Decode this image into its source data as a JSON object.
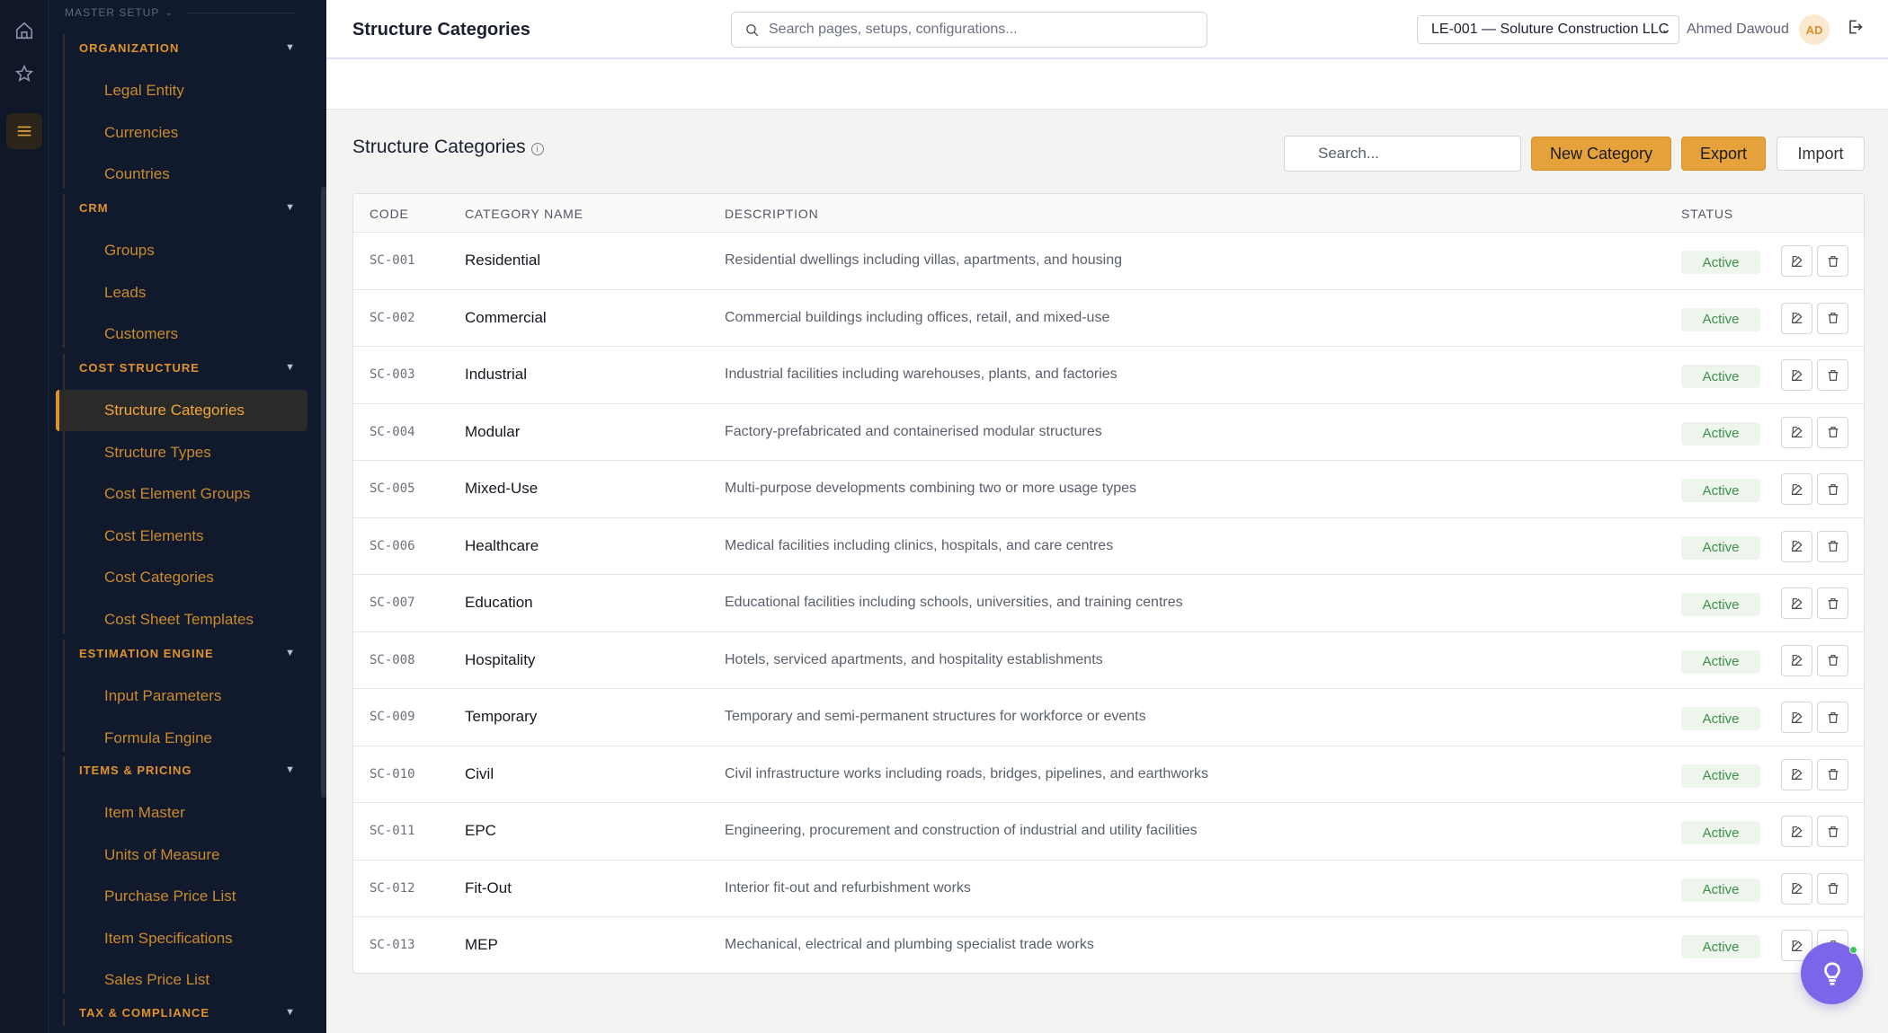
{
  "sidebar": {
    "section_label": "MASTER SETUP",
    "groups": [
      {
        "title": "ORGANIZATION",
        "items": [
          "Legal Entity",
          "Currencies",
          "Countries"
        ]
      },
      {
        "title": "CRM",
        "items": [
          "Groups",
          "Leads",
          "Customers"
        ]
      },
      {
        "title": "COST STRUCTURE",
        "items": [
          "Structure Categories",
          "Structure Types",
          "Cost Element Groups",
          "Cost Elements",
          "Cost Categories",
          "Cost Sheet Templates"
        ]
      },
      {
        "title": "ESTIMATION ENGINE",
        "items": [
          "Input Parameters",
          "Formula Engine"
        ]
      },
      {
        "title": "ITEMS & PRICING",
        "items": [
          "Item Master",
          "Units of Measure",
          "Purchase Price List",
          "Item Specifications",
          "Sales Price List"
        ]
      },
      {
        "title": "TAX & COMPLIANCE",
        "items": []
      }
    ],
    "active_item": "Structure Categories"
  },
  "header": {
    "title": "Structure Categories",
    "search_placeholder": "Search pages, setups, configurations...",
    "entity": "LE-001 — Soluture Construction LLC",
    "user_name": "Ahmed Dawoud",
    "avatar_initials": "AD"
  },
  "main": {
    "title": "Structure Categories",
    "info_glyph": "i",
    "search_placeholder": "Search...",
    "buttons": {
      "new": "New Category",
      "export": "Export",
      "import": "Import"
    },
    "columns": {
      "code": "CODE",
      "name": "CATEGORY NAME",
      "description": "DESCRIPTION",
      "status": "STATUS"
    },
    "rows": [
      {
        "code": "SC-001",
        "name": "Residential",
        "description": "Residential dwellings including villas, apartments, and housing",
        "status": "Active"
      },
      {
        "code": "SC-002",
        "name": "Commercial",
        "description": "Commercial buildings including offices, retail, and mixed-use",
        "status": "Active"
      },
      {
        "code": "SC-003",
        "name": "Industrial",
        "description": "Industrial facilities including warehouses, plants, and factories",
        "status": "Active"
      },
      {
        "code": "SC-004",
        "name": "Modular",
        "description": "Factory-prefabricated and containerised modular structures",
        "status": "Active"
      },
      {
        "code": "SC-005",
        "name": "Mixed-Use",
        "description": "Multi-purpose developments combining two or more usage types",
        "status": "Active"
      },
      {
        "code": "SC-006",
        "name": "Healthcare",
        "description": "Medical facilities including clinics, hospitals, and care centres",
        "status": "Active"
      },
      {
        "code": "SC-007",
        "name": "Education",
        "description": "Educational facilities including schools, universities, and training centres",
        "status": "Active"
      },
      {
        "code": "SC-008",
        "name": "Hospitality",
        "description": "Hotels, serviced apartments, and hospitality establishments",
        "status": "Active"
      },
      {
        "code": "SC-009",
        "name": "Temporary",
        "description": "Temporary and semi-permanent structures for workforce or events",
        "status": "Active"
      },
      {
        "code": "SC-010",
        "name": "Civil",
        "description": "Civil infrastructure works including roads, bridges, pipelines, and earthworks",
        "status": "Active"
      },
      {
        "code": "SC-011",
        "name": "EPC",
        "description": "Engineering, procurement and construction of industrial and utility facilities",
        "status": "Active"
      },
      {
        "code": "SC-012",
        "name": "Fit-Out",
        "description": "Interior fit-out and refurbishment works",
        "status": "Active"
      },
      {
        "code": "SC-013",
        "name": "MEP",
        "description": "Mechanical, electrical and plumbing specialist trade works",
        "status": "Active"
      }
    ]
  },
  "icons": {
    "rail": [
      "home-icon",
      "star-icon",
      "menu-icon"
    ],
    "row_actions": [
      "edit-icon",
      "trash-icon"
    ],
    "fab": "lightbulb-icon"
  },
  "colors": {
    "accent": "#e6a23a",
    "sidebar_bg": "#111a2c",
    "status_active": "#3d8f4a",
    "fab": "#7c65e9"
  }
}
